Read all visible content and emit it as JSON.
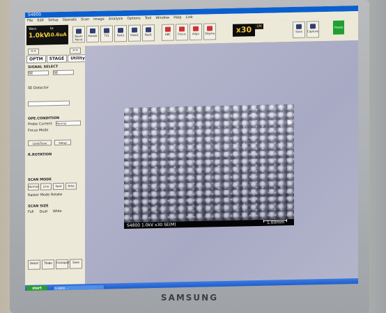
{
  "window": {
    "title": "S4800"
  },
  "menu": [
    "File",
    "Edit",
    "Setup",
    "Operate",
    "Scan",
    "Image",
    "Analysis",
    "Options",
    "Tool",
    "Window",
    "Help",
    "Link"
  ],
  "status": {
    "vacc_label": "Vacc",
    "vacc_value": "1.0kV",
    "ie_label": "Ie",
    "ie_value": "10.6uA"
  },
  "toolbar": {
    "buttons": [
      "Beam Monit",
      "Freeze",
      "TV1",
      "Fast1",
      "Slow1",
      "Red1",
      "ABC",
      "Focus",
      "Align",
      "Stigma"
    ],
    "mag": "x30",
    "mode": "LM",
    "right_buttons": [
      "Save",
      "Capture",
      "Freeze"
    ]
  },
  "sidebar": {
    "nav_prev": "<<",
    "nav_next": ">>",
    "tabs": [
      "OPTM",
      "STAGE",
      "Utility"
    ],
    "signal_select": "SIGNAL SELECT",
    "signal_value": "SE",
    "signal_value2": "SE",
    "se_detector": "SE Detector",
    "opecondition": "OPE.CONDITION",
    "probe_current": "Probe Current",
    "probe_value": "Normal",
    "focus_mode": "Focus Mode",
    "load_save": [
      "Load/Save",
      "Setup"
    ],
    "rrotation": "R.ROTATION",
    "scan_mode": "SCAN MODE",
    "scan_mode_buttons": [
      "Normal",
      "Line",
      "Spot",
      "Area"
    ],
    "raster": "Raster Mode Rotate",
    "scan_size": "SCAN SIZE",
    "scan_size_opts": [
      "Full",
      "Dual",
      "Wide"
    ],
    "bottom_buttons": [
      "Detail",
      "Stage",
      "Crosspoint",
      "Save"
    ]
  },
  "image": {
    "caption_left": "S4800 1.0kV x30 SE(M)",
    "caption_right": "1.00mm"
  },
  "taskbar": {
    "start": "start",
    "item": "S-4800 ..."
  },
  "bezel": {
    "brand": "SAMSUNG"
  }
}
